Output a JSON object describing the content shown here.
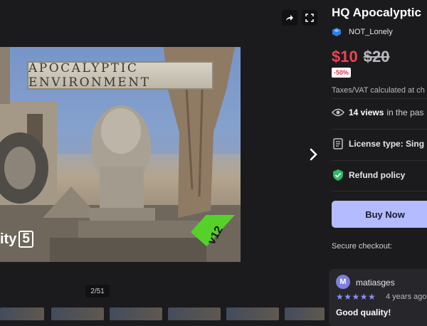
{
  "product": {
    "title": "HQ Apocalyptic",
    "seller": "NOT_Lonely",
    "price_now": "$10",
    "price_was": "$20",
    "discount": "-50%",
    "taxes_note": "Taxes/VAT calculated at ch",
    "views_count": "14 views",
    "views_suffix": "in the pas",
    "license_label": "License type: Sing",
    "refund_label": "Refund policy",
    "buy_label": "Buy Now",
    "secure_label": "Secure checkout:"
  },
  "gallery": {
    "banner_text": "APOCALYPTIC ENVIRONMENT",
    "engine_label": "ity",
    "engine_version": "5",
    "version_badge": "v12",
    "counter": "2/51",
    "share_icon": "share-icon",
    "fullscreen_icon": "fullscreen-icon",
    "next_icon": "chevron-right-icon"
  },
  "review": {
    "avatar_letter": "M",
    "user": "matiasges",
    "stars": "★★★★★",
    "rating": 5,
    "date": "4 years ago",
    "title": "Good quality!"
  },
  "colors": {
    "background": "#1b1b1e",
    "price_red": "#ef4452",
    "buy_button": "#b4bbff",
    "refund_green": "#2fb866",
    "star_color": "#8a8ff0",
    "badge_green": "#55d12a"
  }
}
